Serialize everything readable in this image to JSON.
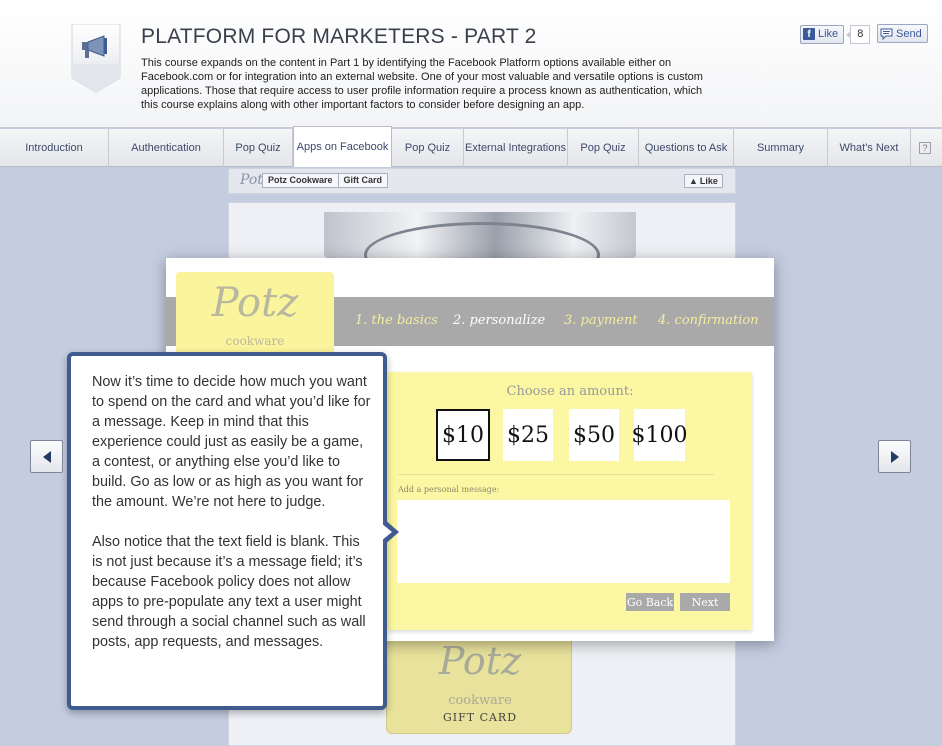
{
  "header": {
    "title": "PLATFORM FOR MARKETERS - PART 2",
    "description": "This course expands on the content in Part 1 by identifying the Facebook Platform options available either on Facebook.com or for integration into an external website. One of your most valuable and versatile options is custom applications. Those that require access to user profile information require a process known as authentication, which this course explains along with other important factors to consider before designing an app.",
    "badge_icon": "megaphone-icon",
    "like_label": "Like",
    "like_count": "8",
    "send_label": "Send"
  },
  "tabs": [
    {
      "label": "Introduction"
    },
    {
      "label": "Authentication"
    },
    {
      "label": "Pop Quiz"
    },
    {
      "label": "Apps on Facebook",
      "active": true
    },
    {
      "label": "Pop Quiz"
    },
    {
      "label": "External Integrations"
    },
    {
      "label": "Pop Quiz"
    },
    {
      "label": "Questions to Ask"
    },
    {
      "label": "Summary"
    },
    {
      "label": "What's Next"
    }
  ],
  "help_label": "?",
  "background_page": {
    "logo": "Potz",
    "crumbs": [
      "Potz Cookware",
      "Gift Card"
    ],
    "like_label": "Like"
  },
  "app": {
    "logo": "Potz",
    "logo_sub": "cookware",
    "steps": [
      "1. the basics",
      "2. personalize",
      "3. payment",
      "4. confirmation"
    ],
    "current_step": 1,
    "amount_title": "Choose an amount:",
    "amounts": [
      "$10",
      "$25",
      "$50",
      "$100"
    ],
    "selected_amount": "$10",
    "message_label": "Add a personal message:",
    "message_value": "",
    "back_label": "Go Back",
    "next_label": "Next"
  },
  "giftcard": {
    "logo": "Potz",
    "sub": "cookware",
    "label": "GIFT CARD"
  },
  "callout": {
    "paragraph1": "Now it’s time to decide how much you want to spend on the card and what you’d like for a message. Keep in mind that this experience could just as easily be a game, a contest, or anything else you’d like to build. Go as low or as high as you want for the amount. We’re not here to judge.",
    "paragraph2": "Also notice that the text field is blank. This is not just because it’s a message field; it’s because Facebook policy does not allow apps to pre-populate any text a user might send through a social channel such as wall posts, app requests, and messages."
  },
  "colors": {
    "accent": "#3f5b8f",
    "card_yellow": "#fcf7a2",
    "step_bar": "#a9a9a9"
  }
}
